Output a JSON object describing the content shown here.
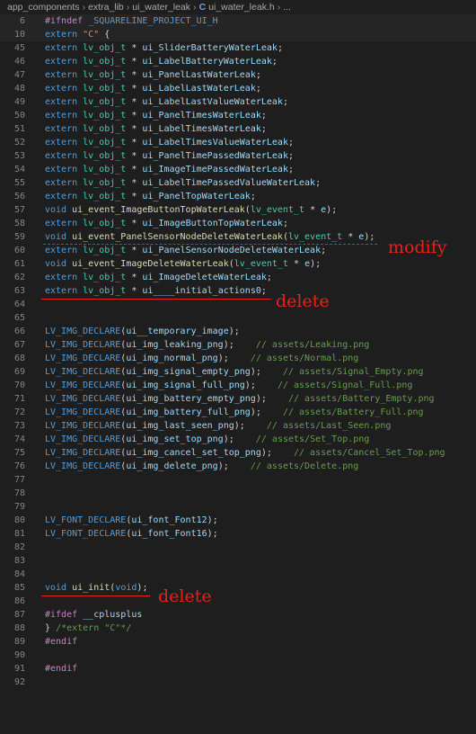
{
  "breadcrumb": {
    "parts": [
      "app_components",
      "extra_lib",
      "ui_water_leak",
      "ui_water_leak.h",
      "..."
    ],
    "file_icon": "C"
  },
  "sticky_lines": [
    {
      "n": "6",
      "text": "#ifndef _SQUARELINE_PROJECT_UI_H"
    },
    {
      "n": "10",
      "text": "extern \"C\" {"
    }
  ],
  "lines": [
    {
      "n": "45",
      "text": "extern lv_obj_t * ui_SliderBatteryWaterLeak;"
    },
    {
      "n": "46",
      "text": "extern lv_obj_t * ui_LabelBatteryWaterLeak;"
    },
    {
      "n": "47",
      "text": "extern lv_obj_t * ui_PanelLastWaterLeak;"
    },
    {
      "n": "48",
      "text": "extern lv_obj_t * ui_LabelLastWaterLeak;"
    },
    {
      "n": "49",
      "text": "extern lv_obj_t * ui_LabelLastValueWaterLeak;"
    },
    {
      "n": "50",
      "text": "extern lv_obj_t * ui_PanelTimesWaterLeak;"
    },
    {
      "n": "51",
      "text": "extern lv_obj_t * ui_LabelTimesWaterLeak;"
    },
    {
      "n": "52",
      "text": "extern lv_obj_t * ui_LabelTimesValueWaterLeak;"
    },
    {
      "n": "53",
      "text": "extern lv_obj_t * ui_PanelTimePassedWaterLeak;"
    },
    {
      "n": "54",
      "text": "extern lv_obj_t * ui_ImageTimePassedWaterLeak;"
    },
    {
      "n": "55",
      "text": "extern lv_obj_t * ui_LabelTimePassedValueWaterLeak;"
    },
    {
      "n": "56",
      "text": "extern lv_obj_t * ui_PanelTopWaterLeak;"
    },
    {
      "n": "57",
      "text": "void ui_event_ImageButtonTopWaterLeak(lv_event_t * e);"
    },
    {
      "n": "58",
      "text": "extern lv_obj_t * ui_ImageButtonTopWaterLeak;"
    },
    {
      "n": "59",
      "text": "void ui_event_PanelSensorNodeDeleteWaterLeak(lv_event_t * e);"
    },
    {
      "n": "60",
      "text": "extern lv_obj_t * ui_PanelSensorNodeDeleteWaterLeak;"
    },
    {
      "n": "61",
      "text": "void ui_event_ImageDeleteWaterLeak(lv_event_t * e);"
    },
    {
      "n": "62",
      "text": "extern lv_obj_t * ui_ImageDeleteWaterLeak;"
    },
    {
      "n": "63",
      "text": "extern lv_obj_t * ui____initial_actions0;"
    },
    {
      "n": "64",
      "text": ""
    },
    {
      "n": "65",
      "text": ""
    },
    {
      "n": "66",
      "text": "LV_IMG_DECLARE(ui__temporary_image);"
    },
    {
      "n": "67",
      "text": "LV_IMG_DECLARE(ui_img_leaking_png);    // assets/Leaking.png"
    },
    {
      "n": "68",
      "text": "LV_IMG_DECLARE(ui_img_normal_png);    // assets/Normal.png"
    },
    {
      "n": "69",
      "text": "LV_IMG_DECLARE(ui_img_signal_empty_png);    // assets/Signal_Empty.png"
    },
    {
      "n": "70",
      "text": "LV_IMG_DECLARE(ui_img_signal_full_png);    // assets/Signal_Full.png"
    },
    {
      "n": "71",
      "text": "LV_IMG_DECLARE(ui_img_battery_empty_png);    // assets/Battery_Empty.png"
    },
    {
      "n": "72",
      "text": "LV_IMG_DECLARE(ui_img_battery_full_png);    // assets/Battery_Full.png"
    },
    {
      "n": "73",
      "text": "LV_IMG_DECLARE(ui_img_last_seen_png);    // assets/Last_Seen.png"
    },
    {
      "n": "74",
      "text": "LV_IMG_DECLARE(ui_img_set_top_png);    // assets/Set_Top.png"
    },
    {
      "n": "75",
      "text": "LV_IMG_DECLARE(ui_img_cancel_set_top_png);    // assets/Cancel_Set_Top.png"
    },
    {
      "n": "76",
      "text": "LV_IMG_DECLARE(ui_img_delete_png);    // assets/Delete.png"
    },
    {
      "n": "77",
      "text": ""
    },
    {
      "n": "78",
      "text": ""
    },
    {
      "n": "79",
      "text": ""
    },
    {
      "n": "80",
      "text": "LV_FONT_DECLARE(ui_font_Font12);"
    },
    {
      "n": "81",
      "text": "LV_FONT_DECLARE(ui_font_Font16);"
    },
    {
      "n": "82",
      "text": ""
    },
    {
      "n": "83",
      "text": ""
    },
    {
      "n": "84",
      "text": ""
    },
    {
      "n": "85",
      "text": "void ui_init(void);"
    },
    {
      "n": "86",
      "text": ""
    },
    {
      "n": "87",
      "text": "#ifdef __cplusplus"
    },
    {
      "n": "88",
      "text": "} /*extern \"C\"*/"
    },
    {
      "n": "89",
      "text": "#endif"
    },
    {
      "n": "90",
      "text": ""
    },
    {
      "n": "91",
      "text": "#endif"
    },
    {
      "n": "92",
      "text": ""
    }
  ],
  "annotations": [
    {
      "id": "modify",
      "label": "modify",
      "line": "59"
    },
    {
      "id": "delete-63",
      "label": "delete",
      "line": "63"
    },
    {
      "id": "delete-85",
      "label": "delete",
      "line": "85"
    }
  ],
  "colors": {
    "background": "#1e1e1e",
    "sticky_background": "#252526",
    "annotation": "#e8201f",
    "keyword": "#569cd6",
    "type": "#4ec9b0",
    "identifier": "#9cdcfe",
    "function": "#dcdcaa",
    "string": "#ce9178",
    "comment": "#6a9955",
    "preprocessor": "#c586c0"
  }
}
